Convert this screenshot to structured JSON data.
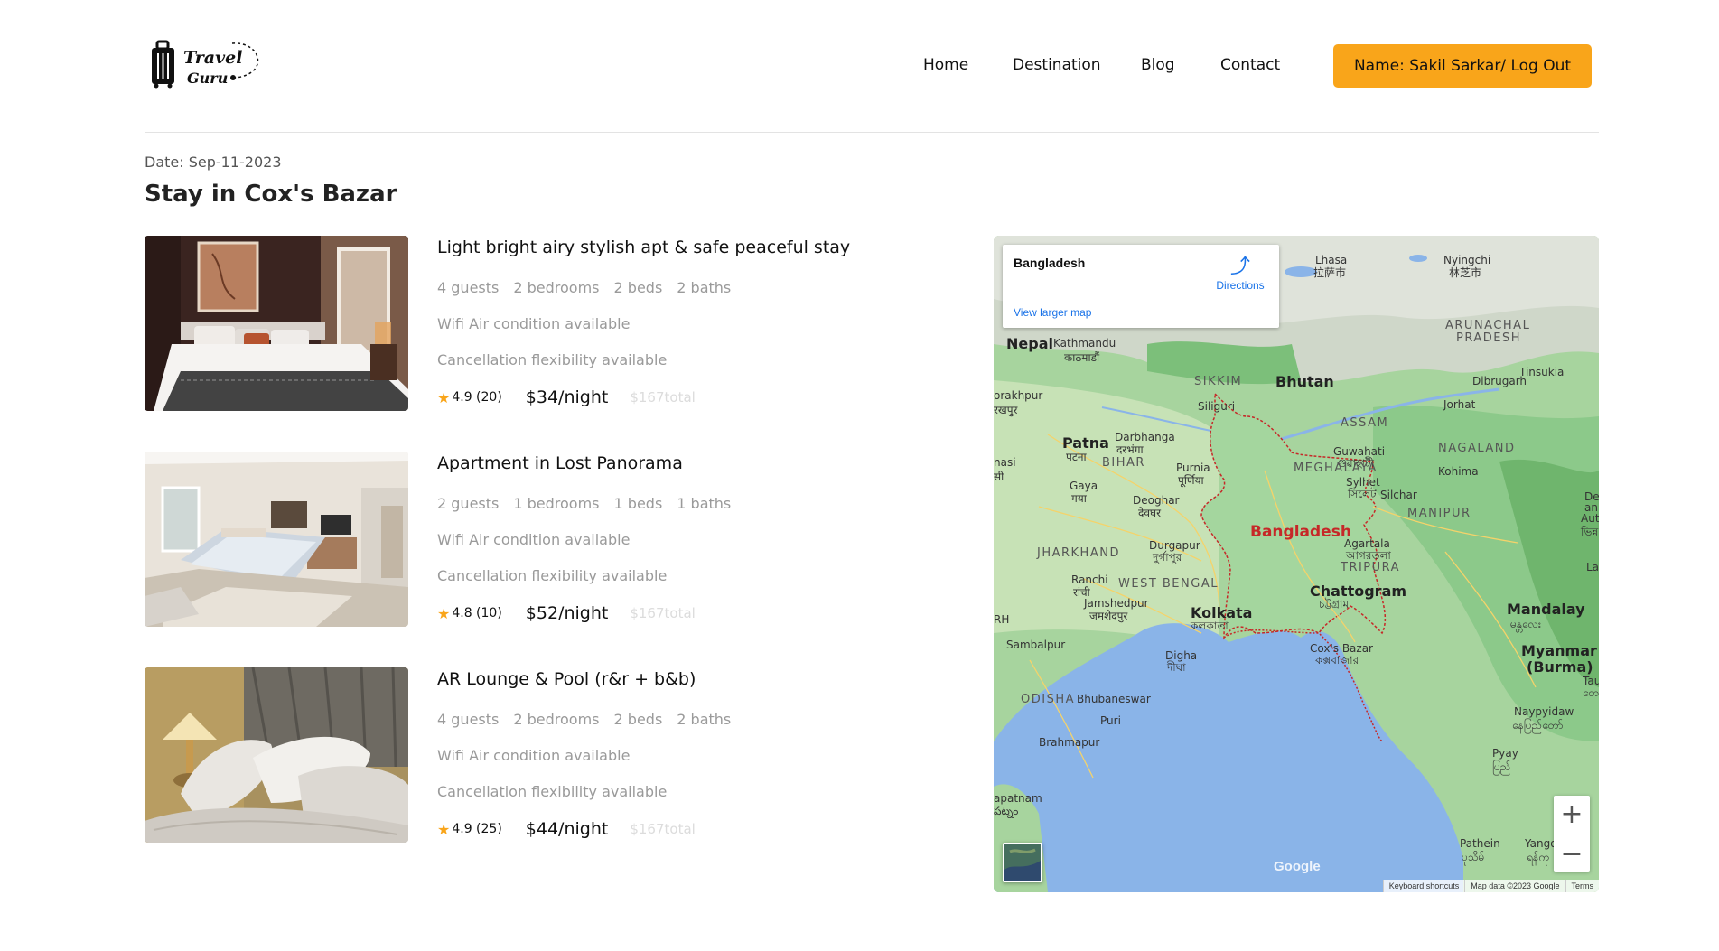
{
  "header": {
    "logo": {
      "line1": "Travel",
      "line2": "Guru"
    },
    "nav": [
      "Home",
      "Destination",
      "Blog",
      "Contact"
    ],
    "user_button": "Name: Sakil Sarkar/ Log Out"
  },
  "colors": {
    "accent": "#f9a51a",
    "muted_text": "#9a9a9a",
    "faint_text": "#dcdcdc",
    "border_red": "#c62828"
  },
  "page": {
    "date": "Date: Sep-11-2023",
    "title": "Stay in Cox's Bazar"
  },
  "listings": [
    {
      "title": "Light bright airy stylish apt & safe peaceful stay",
      "guests": "4 guests",
      "bedrooms": "2 bedrooms",
      "beds": "2 beds",
      "baths": "2 baths",
      "amenities": "Wifi Air condition available",
      "cancellation": "Cancellation flexibility available",
      "rating": "4.9 (20)",
      "price": "$34/night",
      "total": "$167total"
    },
    {
      "title": "Apartment in Lost Panorama",
      "guests": "2 guests",
      "bedrooms": "1 bedrooms",
      "beds": "1 beds",
      "baths": "1 baths",
      "amenities": "Wifi Air condition available",
      "cancellation": "Cancellation flexibility available",
      "rating": "4.8 (10)",
      "price": "$52/night",
      "total": "$167total"
    },
    {
      "title": "AR Lounge & Pool (r&r + b&b)",
      "guests": "4 guests",
      "bedrooms": "2 bedrooms",
      "beds": "2 beds",
      "baths": "2 baths",
      "amenities": "Wifi Air condition available",
      "cancellation": "Cancellation flexibility available",
      "rating": "4.9 (25)",
      "price": "$44/night",
      "total": "$167total"
    }
  ],
  "map": {
    "place": "Bangladesh",
    "directions": "Directions",
    "larger_map": "View larger map",
    "zoom_in": "+",
    "zoom_out": "−",
    "google": "Google",
    "attribution": {
      "shortcuts": "Keyboard shortcuts",
      "data": "Map data ©2023 Google",
      "terms": "Terms"
    },
    "labels": {
      "nepal": "Nepal",
      "kathmandu": "Kathmandu",
      "kathmandu_local": "काठमाडौं",
      "lhasa": "Lhasa",
      "lhasa_local": "拉萨市",
      "nyingchi": "Nyingchi",
      "nyingchi_local": "林芝市",
      "arunachal": "ARUNACHAL",
      "pradesh": "PRADESH",
      "tinsukia": "Tinsukia",
      "dibrugarh": "Dibrugarh",
      "jorhat": "Jorhat",
      "sikkim": "SIKKIM",
      "bhutan": "Bhutan",
      "siliguri": "Siliguri",
      "assam": "ASSAM",
      "nagaland": "NAGALAND",
      "kohima": "Kohima",
      "gorakhpur": "orakhpur",
      "gorakhpur_local": "रखपुर",
      "patna": "Patna",
      "patna_local": "पटना",
      "darbhanga": "Darbhanga",
      "darbhanga_local": "दरभंगा",
      "bihar": "BIHAR",
      "purnia": "Purnia",
      "purnia_local": "पूर्णिया",
      "guwahati": "Guwahati",
      "guwahati_local": "গুৱাহাটী",
      "meghalaya": "MEGHALAYA",
      "sylhet": "Sylhet",
      "sylhet_local": "সিলেট",
      "silchar": "Silchar",
      "varanasi": "nasi",
      "varanasi_local": "सी",
      "gaya": "Gaya",
      "gaya_local": "गया",
      "deoghar": "Deoghar",
      "deoghar_local": "देवघर",
      "manipur": "MANIPUR",
      "bangladesh": "Bangladesh",
      "agartala": "Agartala",
      "agartala_local": "আগরতলা",
      "tripura": "TRIPURA",
      "jharkhand": "JHARKHAND",
      "durgapur": "Durgapur",
      "durgapur_local": "দুর্গাপুর",
      "chattogram": "Chattogram",
      "chattogram_local": "চট্টগ্রাম",
      "ranchi": "Ranchi",
      "ranchi_local": "रांची",
      "westbengal": "WEST BENGAL",
      "jamshedpur": "Jamshedpur",
      "jamshedpur_local": "जमशेदपुर",
      "kolkata": "Kolkata",
      "kolkata_local": "কলকাতা",
      "mandalay": "Mandalay",
      "mandalay_local": "မန္တလေး",
      "rh": "RH",
      "sambalpur": "Sambalpur",
      "coxsbazar": "Cox's Bazar",
      "coxsbazar_local": "কক্সবাজার",
      "digha": "Digha",
      "digha_local": "দীঘা",
      "myanmar": "Myanmar",
      "burma": "(Burma)",
      "odisha": "ODISHA",
      "bhubaneswar": "Bhubaneswar",
      "taunggyi": "Tau",
      "taunggyi_local": "တေ",
      "naypyidaw": "Naypyidaw",
      "naypyidaw_local": "နေပြည်တော်",
      "puri": "Puri",
      "brahmapur": "Brahmapur",
      "pyay": "Pyay",
      "pyay_local": "ပြည်",
      "vizag": "apatnam",
      "vizag_local": "పట్నం",
      "pathein": "Pathein",
      "pathein_local": "ပုသိမ်",
      "yangon": "Yango",
      "yangon_local": "ရန်ကု",
      "delhi": "Del",
      "an": "an",
      "auto": "Auto",
      "misc_local": "ভিন্ন",
      "la": "La"
    }
  }
}
